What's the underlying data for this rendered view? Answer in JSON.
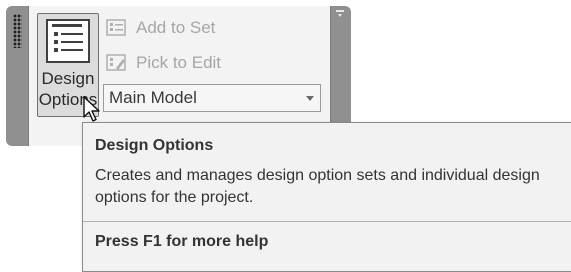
{
  "ribbon": {
    "design_options": {
      "label_line1": "Design",
      "label_line2": "Options",
      "icon": "design-options-icon"
    },
    "add_to_set": {
      "label": "Add to Set",
      "icon": "add-to-set-icon",
      "enabled": false
    },
    "pick_to_edit": {
      "label": "Pick to Edit",
      "icon": "pick-to-edit-icon",
      "enabled": false
    },
    "active_option": {
      "value": "Main Model"
    }
  },
  "tooltip": {
    "title": "Design Options",
    "body": "Creates and manages design option sets and individual design options for the project.",
    "help": "Press F1 for more help"
  },
  "colors": {
    "panel_frame": "#909090",
    "panel_background": "#f3f3f3",
    "disabled_text": "#a6a6a6",
    "tooltip_background": "#f2f2f2"
  }
}
